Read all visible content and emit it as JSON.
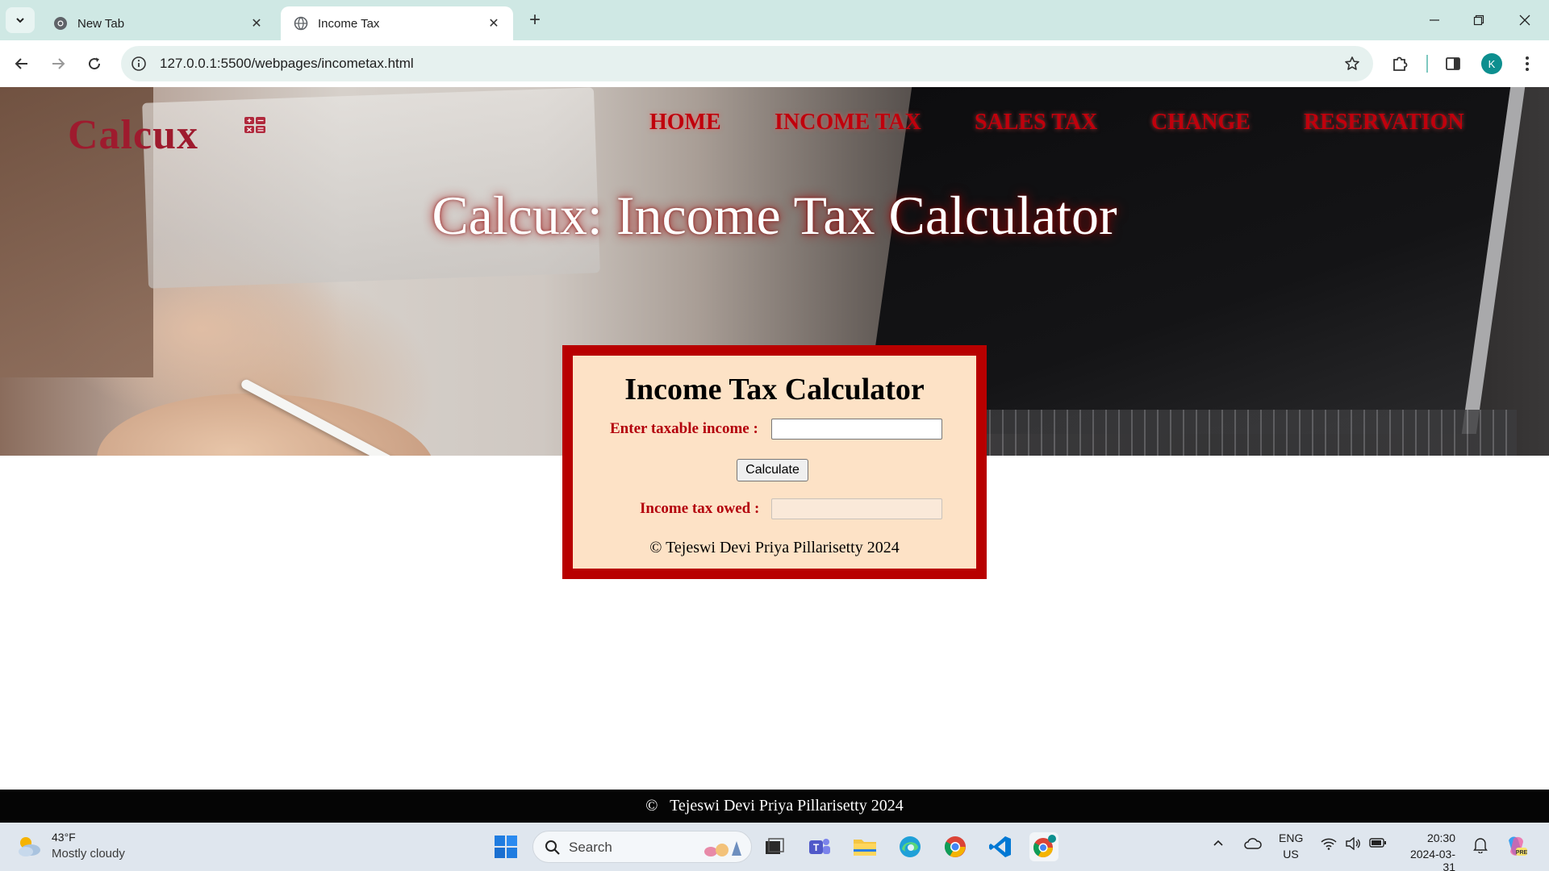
{
  "browser": {
    "tabs": [
      {
        "title": "New Tab"
      },
      {
        "title": "Income Tax"
      }
    ],
    "url": "127.0.0.1:5500/webpages/incometax.html",
    "profile_initial": "K"
  },
  "site": {
    "logo": "Calcux",
    "nav": [
      "HOME",
      "INCOME TAX",
      "SALES TAX",
      "CHANGE",
      "RESERVATION"
    ],
    "hero_title": "Calcux: Income Tax Calculator",
    "calculator": {
      "title": "Income Tax Calculator",
      "income_label": "Enter taxable income :",
      "income_value": "",
      "button_label": "Calculate",
      "result_label": "Income tax owed :",
      "result_value": "",
      "copyright": "© Tejeswi Devi Priya Pillarisetty 2024"
    },
    "footer": "©   Tejeswi Devi Priya Pillarisetty 2024"
  },
  "colors": {
    "accent": "#b80000",
    "nav": "#c0000c",
    "logo": "#9e1b2e",
    "panel": "#fde2c6"
  },
  "taskbar": {
    "weather_temp": "43°F",
    "weather_desc": "Mostly cloudy",
    "search_placeholder": "Search",
    "lang_top": "ENG",
    "lang_bottom": "US",
    "time": "20:30",
    "date": "2024-03-31"
  }
}
